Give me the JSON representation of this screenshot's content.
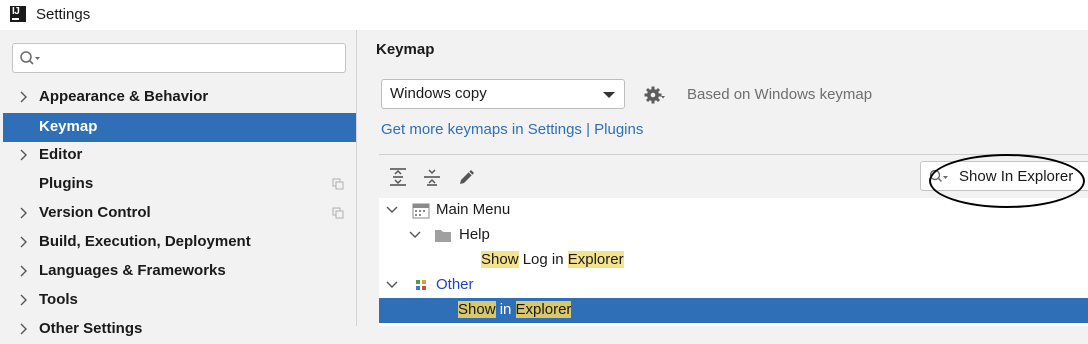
{
  "window": {
    "title": "Settings"
  },
  "search": {
    "value": "",
    "placeholder": ""
  },
  "sidebar": {
    "items": [
      {
        "label": "Appearance & Behavior"
      },
      {
        "label": "Keymap"
      },
      {
        "label": "Editor"
      },
      {
        "label": "Plugins"
      },
      {
        "label": "Version Control"
      },
      {
        "label": "Build, Execution, Deployment"
      },
      {
        "label": "Languages & Frameworks"
      },
      {
        "label": "Tools"
      },
      {
        "label": "Other Settings"
      }
    ]
  },
  "main": {
    "title": "Keymap",
    "keymap_select": "Windows copy",
    "based_on": "Based on Windows keymap",
    "link": "Get more keymaps in Settings | Plugins",
    "filter_value": "Show In Explorer",
    "tree": {
      "main_menu": "Main Menu",
      "help": "Help",
      "show_log": {
        "show": "Show",
        "mid": " Log in ",
        "explorer": "Explorer"
      },
      "other": "Other",
      "show_in": {
        "show": "Show",
        "mid": " in ",
        "explorer": "Explorer"
      }
    }
  },
  "colors": {
    "selection": "#2f6fb7",
    "highlight": "#f4e38c",
    "link": "#2f6fb7"
  }
}
